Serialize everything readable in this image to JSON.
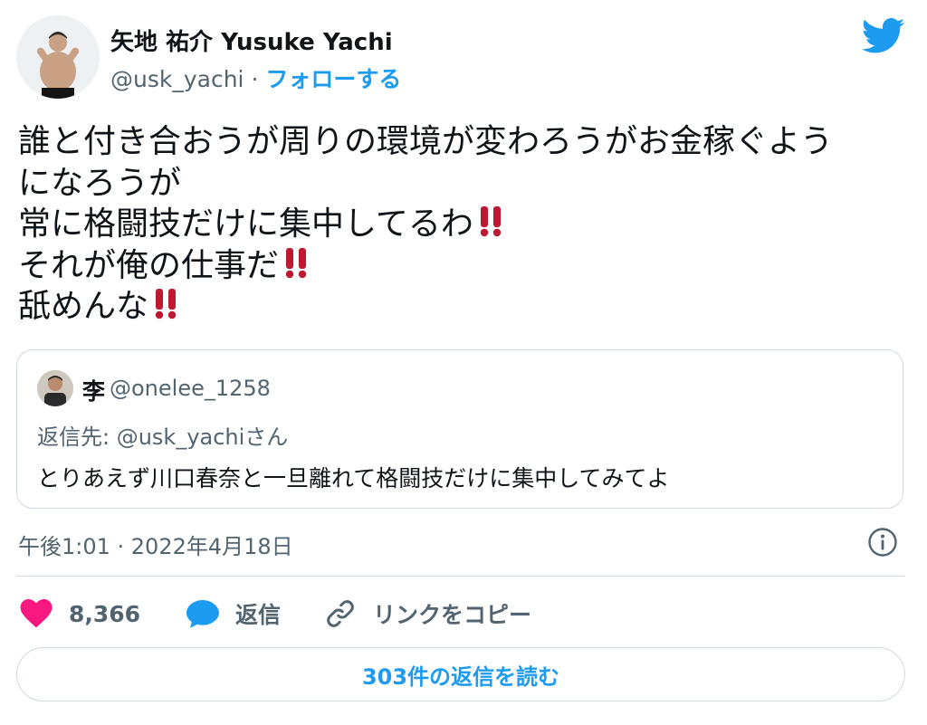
{
  "author": {
    "display_name": "矢地 祐介 Yusuke Yachi",
    "handle": "@usk_yachi",
    "separator": " · ",
    "follow_label": "フォローする"
  },
  "tweet": {
    "lines": [
      "誰と付き合おうが周りの環境が変わろうがお金稼ぐよう",
      "になろうが",
      "常に格闘技だけに集中してるわ",
      "それが俺の仕事だ",
      "舐めんな"
    ]
  },
  "quoted_tweet": {
    "name": "李",
    "handle": "@onelee_1258",
    "reply_to": "返信先: @usk_yachiさん",
    "text": "とりあえず川口春奈と一旦離れて格闘技だけに集中してみてよ"
  },
  "meta": {
    "timestamp": "午後1:01 · 2022年4月18日"
  },
  "actions": {
    "like_count": "8,366",
    "reply_label": "返信",
    "copy_link_label": "リンクをコピー"
  },
  "read_replies_label": "303件の返信を読む",
  "colors": {
    "accent": "#1d9bf0",
    "like": "#f91880",
    "emoji_red": "#be1931",
    "text": "#0f1419",
    "secondary": "#536471",
    "border": "#cfd9de"
  },
  "icons": {
    "brand": "twitter-bird-icon",
    "like": "heart-icon",
    "reply": "speech-bubble-icon",
    "copy_link": "link-icon",
    "info": "info-icon",
    "emoji": "double-exclamation-emoji"
  }
}
